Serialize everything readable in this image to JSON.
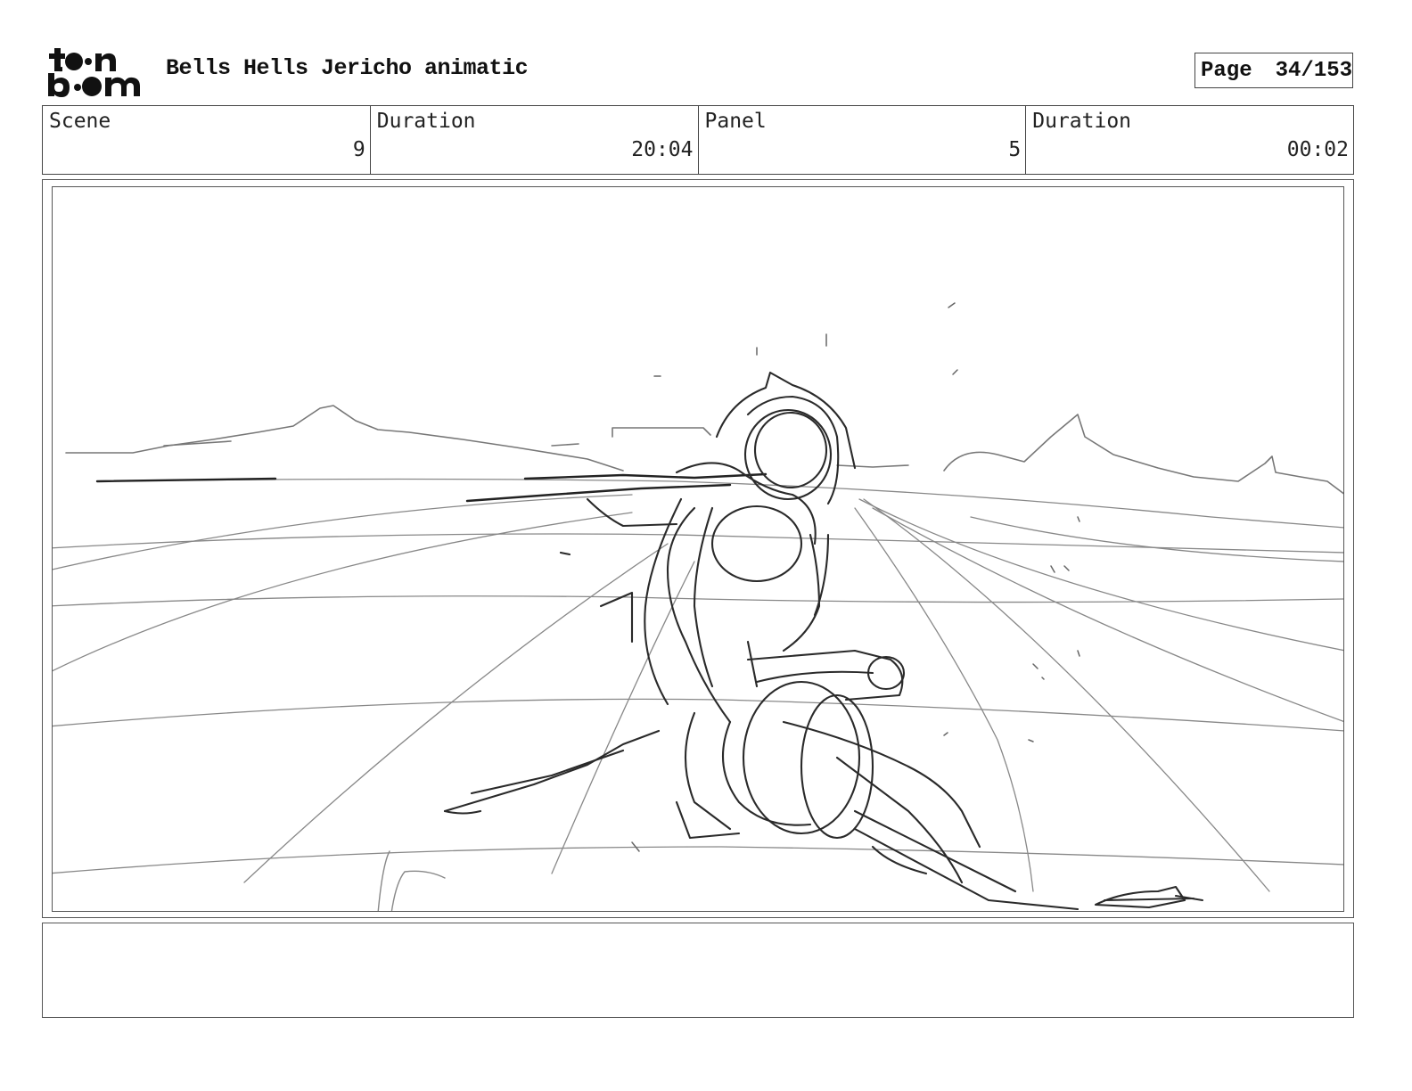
{
  "header": {
    "logo": {
      "icon": "toon-boom-logo-icon",
      "line1": "t••n",
      "line2": "b••m"
    },
    "title": "Bells Hells Jericho animatic",
    "page_label": "Page",
    "page_number": "34/153"
  },
  "info": {
    "scene_label": "Scene",
    "scene_value": "9",
    "scene_duration_label": "Duration",
    "scene_duration_value": "20:04",
    "panel_label": "Panel",
    "panel_value": "5",
    "panel_duration_label": "Duration",
    "panel_duration_value": "00:02"
  },
  "panel": {
    "image": "rough-sketch-figure-kneeling-desert-icon"
  },
  "notes": {
    "text": ""
  }
}
